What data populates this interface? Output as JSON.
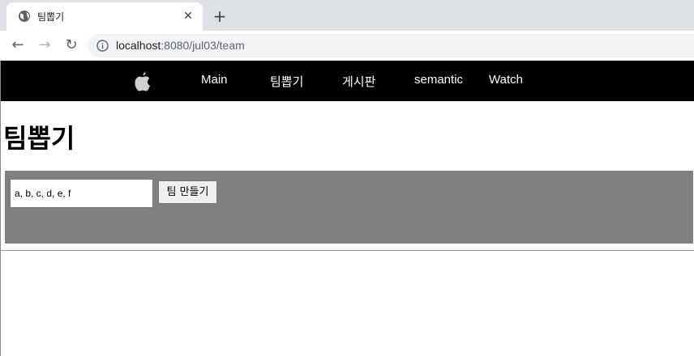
{
  "browser": {
    "tab_title": "팀뽑기",
    "close_glyph": "✕",
    "new_tab_glyph": "+",
    "back_glyph": "←",
    "forward_glyph": "→",
    "reload_glyph": "↻",
    "url_host": "localhost",
    "url_path": ":8080/jul03/team"
  },
  "nav": {
    "logo_icon": "apple-icon",
    "links": [
      "Main",
      "팀뽑기",
      "게시판",
      "semantic",
      "Watch"
    ]
  },
  "page": {
    "heading": "팀뽑기"
  },
  "team_form": {
    "input_value": "a, b, c, d, e, f",
    "button_label": "팀 만들기"
  },
  "colors": {
    "nav_bg": "#000000",
    "panel_bg": "#808080",
    "tabstrip_bg": "#dee1e6",
    "omnibox_bg": "#f1f3f4"
  }
}
